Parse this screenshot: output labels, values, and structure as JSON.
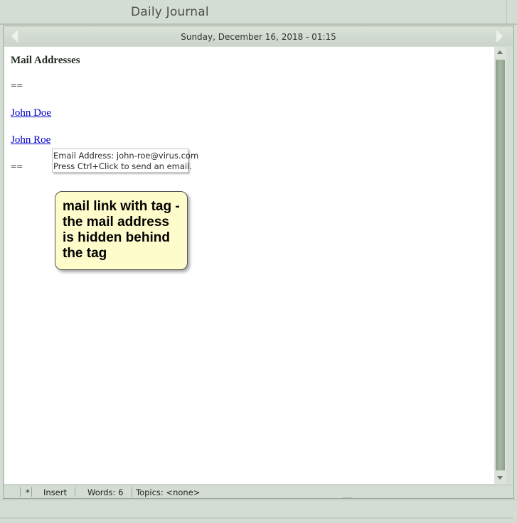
{
  "window": {
    "title": "Daily Journal"
  },
  "datebar": {
    "date": "Sunday, December 16, 2018 - 01:15"
  },
  "editor": {
    "heading": "Mail Addresses",
    "separator_top": "==",
    "link1": "John Doe",
    "link2": "John Roe",
    "separator_bottom": "=="
  },
  "tooltip": {
    "line1": "Email Address: john-roe@virus.com",
    "line2": "Press Ctrl+Click to send an email."
  },
  "callout": {
    "lines": [
      "mail link with tag -",
      "the mail address",
      "is hidden behind",
      "the tag"
    ]
  },
  "statusbar": {
    "modified": "*",
    "mode": "Insert",
    "words": "Words: 6",
    "topics": "Topics: <none>"
  },
  "colors": {
    "frame": "#d4ddd3",
    "link": "#0000cc",
    "callout_fill": "#fffccb",
    "scroll_thumb": "#a9b8a6"
  }
}
